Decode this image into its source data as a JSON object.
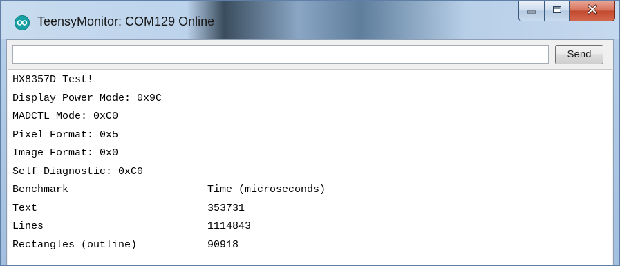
{
  "window": {
    "title": "TeensyMonitor: COM129 Online",
    "app_icon": "arduino-infinity-icon",
    "caption_buttons": [
      "minimize-icon",
      "maximize-icon",
      "close-icon"
    ]
  },
  "input": {
    "value": "",
    "placeholder": ""
  },
  "send_button": {
    "label": "Send"
  },
  "output": {
    "lines": [
      "HX8357D Test!",
      "Display Power Mode: 0x9C",
      "MADCTL Mode: 0xC0",
      "Pixel Format: 0x5",
      "Image Format: 0x0",
      "Self Diagnostic: 0xC0"
    ],
    "benchmark_rows": [
      {
        "name": "Benchmark",
        "value": "Time (microseconds)"
      },
      {
        "name": "Text",
        "value": "353731"
      },
      {
        "name": "Lines",
        "value": "1114843"
      },
      {
        "name": "Rectangles (outline)",
        "value": "90918"
      }
    ]
  },
  "colors": {
    "icon_teal": "#17a1a5",
    "close_red": "#c24a2f"
  }
}
